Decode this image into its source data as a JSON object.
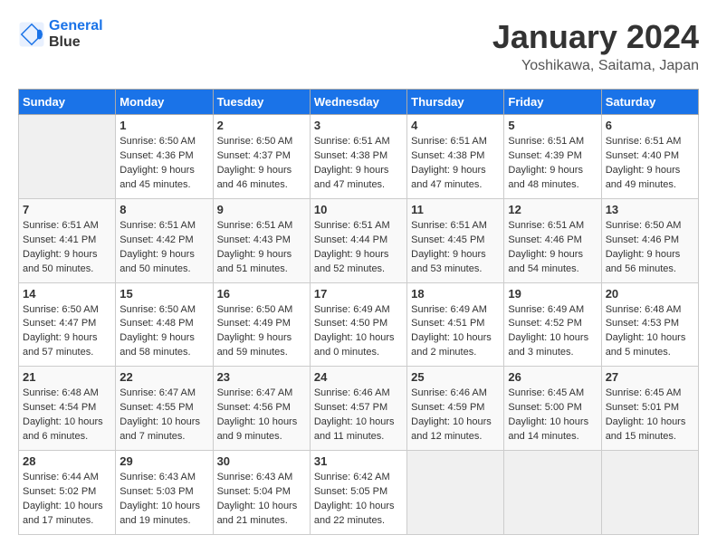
{
  "header": {
    "logo_line1": "General",
    "logo_line2": "Blue",
    "month": "January 2024",
    "location": "Yoshikawa, Saitama, Japan"
  },
  "days_of_week": [
    "Sunday",
    "Monday",
    "Tuesday",
    "Wednesday",
    "Thursday",
    "Friday",
    "Saturday"
  ],
  "weeks": [
    [
      {
        "day": "",
        "sunrise": "",
        "sunset": "",
        "daylight": "",
        "empty": true
      },
      {
        "day": "1",
        "sunrise": "6:50 AM",
        "sunset": "4:36 PM",
        "daylight": "9 hours and 45 minutes."
      },
      {
        "day": "2",
        "sunrise": "6:50 AM",
        "sunset": "4:37 PM",
        "daylight": "9 hours and 46 minutes."
      },
      {
        "day": "3",
        "sunrise": "6:51 AM",
        "sunset": "4:38 PM",
        "daylight": "9 hours and 47 minutes."
      },
      {
        "day": "4",
        "sunrise": "6:51 AM",
        "sunset": "4:38 PM",
        "daylight": "9 hours and 47 minutes."
      },
      {
        "day": "5",
        "sunrise": "6:51 AM",
        "sunset": "4:39 PM",
        "daylight": "9 hours and 48 minutes."
      },
      {
        "day": "6",
        "sunrise": "6:51 AM",
        "sunset": "4:40 PM",
        "daylight": "9 hours and 49 minutes."
      }
    ],
    [
      {
        "day": "7",
        "sunrise": "6:51 AM",
        "sunset": "4:41 PM",
        "daylight": "9 hours and 50 minutes."
      },
      {
        "day": "8",
        "sunrise": "6:51 AM",
        "sunset": "4:42 PM",
        "daylight": "9 hours and 50 minutes."
      },
      {
        "day": "9",
        "sunrise": "6:51 AM",
        "sunset": "4:43 PM",
        "daylight": "9 hours and 51 minutes."
      },
      {
        "day": "10",
        "sunrise": "6:51 AM",
        "sunset": "4:44 PM",
        "daylight": "9 hours and 52 minutes."
      },
      {
        "day": "11",
        "sunrise": "6:51 AM",
        "sunset": "4:45 PM",
        "daylight": "9 hours and 53 minutes."
      },
      {
        "day": "12",
        "sunrise": "6:51 AM",
        "sunset": "4:46 PM",
        "daylight": "9 hours and 54 minutes."
      },
      {
        "day": "13",
        "sunrise": "6:50 AM",
        "sunset": "4:46 PM",
        "daylight": "9 hours and 56 minutes."
      }
    ],
    [
      {
        "day": "14",
        "sunrise": "6:50 AM",
        "sunset": "4:47 PM",
        "daylight": "9 hours and 57 minutes."
      },
      {
        "day": "15",
        "sunrise": "6:50 AM",
        "sunset": "4:48 PM",
        "daylight": "9 hours and 58 minutes."
      },
      {
        "day": "16",
        "sunrise": "6:50 AM",
        "sunset": "4:49 PM",
        "daylight": "9 hours and 59 minutes."
      },
      {
        "day": "17",
        "sunrise": "6:49 AM",
        "sunset": "4:50 PM",
        "daylight": "10 hours and 0 minutes."
      },
      {
        "day": "18",
        "sunrise": "6:49 AM",
        "sunset": "4:51 PM",
        "daylight": "10 hours and 2 minutes."
      },
      {
        "day": "19",
        "sunrise": "6:49 AM",
        "sunset": "4:52 PM",
        "daylight": "10 hours and 3 minutes."
      },
      {
        "day": "20",
        "sunrise": "6:48 AM",
        "sunset": "4:53 PM",
        "daylight": "10 hours and 5 minutes."
      }
    ],
    [
      {
        "day": "21",
        "sunrise": "6:48 AM",
        "sunset": "4:54 PM",
        "daylight": "10 hours and 6 minutes."
      },
      {
        "day": "22",
        "sunrise": "6:47 AM",
        "sunset": "4:55 PM",
        "daylight": "10 hours and 7 minutes."
      },
      {
        "day": "23",
        "sunrise": "6:47 AM",
        "sunset": "4:56 PM",
        "daylight": "10 hours and 9 minutes."
      },
      {
        "day": "24",
        "sunrise": "6:46 AM",
        "sunset": "4:57 PM",
        "daylight": "10 hours and 11 minutes."
      },
      {
        "day": "25",
        "sunrise": "6:46 AM",
        "sunset": "4:59 PM",
        "daylight": "10 hours and 12 minutes."
      },
      {
        "day": "26",
        "sunrise": "6:45 AM",
        "sunset": "5:00 PM",
        "daylight": "10 hours and 14 minutes."
      },
      {
        "day": "27",
        "sunrise": "6:45 AM",
        "sunset": "5:01 PM",
        "daylight": "10 hours and 15 minutes."
      }
    ],
    [
      {
        "day": "28",
        "sunrise": "6:44 AM",
        "sunset": "5:02 PM",
        "daylight": "10 hours and 17 minutes."
      },
      {
        "day": "29",
        "sunrise": "6:43 AM",
        "sunset": "5:03 PM",
        "daylight": "10 hours and 19 minutes."
      },
      {
        "day": "30",
        "sunrise": "6:43 AM",
        "sunset": "5:04 PM",
        "daylight": "10 hours and 21 minutes."
      },
      {
        "day": "31",
        "sunrise": "6:42 AM",
        "sunset": "5:05 PM",
        "daylight": "10 hours and 22 minutes."
      },
      {
        "day": "",
        "sunrise": "",
        "sunset": "",
        "daylight": "",
        "empty": true
      },
      {
        "day": "",
        "sunrise": "",
        "sunset": "",
        "daylight": "",
        "empty": true
      },
      {
        "day": "",
        "sunrise": "",
        "sunset": "",
        "daylight": "",
        "empty": true
      }
    ]
  ]
}
